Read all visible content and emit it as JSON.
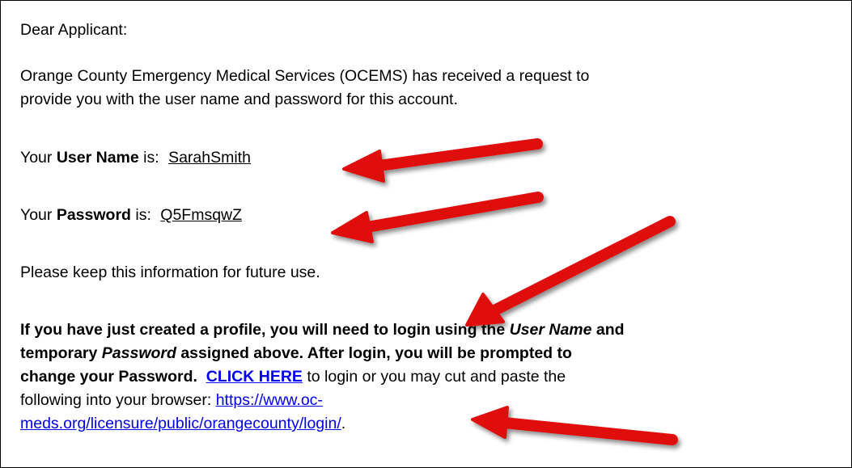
{
  "email": {
    "greeting": "Dear Applicant:",
    "intro_line1": "Orange County Emergency Medical Services (OCEMS) has received a request to",
    "intro_line2": "provide you with the user name and password for this account.",
    "username": {
      "prefix": "Your ",
      "label": "User Name",
      "suffix": " is:",
      "value": "SarahSmith"
    },
    "password": {
      "prefix": "Your ",
      "label": "Password",
      "suffix": " is:",
      "value": "Q5FmsqwZ"
    },
    "keep_info": "Please keep this information for future use.",
    "profile_note": {
      "line1_a": "If you have just created a profile, you will need to login using the ",
      "line1_em": "User Name",
      "line1_b": " and",
      "line2_a": "temporary ",
      "line2_em": "Password",
      "line2_b": " assigned above.  After login, you will be prompted to",
      "line3_bold": "change your Password.",
      "click_here": "CLICK HERE",
      "line3_rest": " to login or you may cut and paste the",
      "line4": "following into your browser: ",
      "url_part1": "https://www.oc-",
      "url_part2": "meds.org/licensure/public/orangecounty/login/",
      "url_end": "."
    }
  },
  "colors": {
    "link": "#0000ee",
    "arrow": "#e01010"
  }
}
